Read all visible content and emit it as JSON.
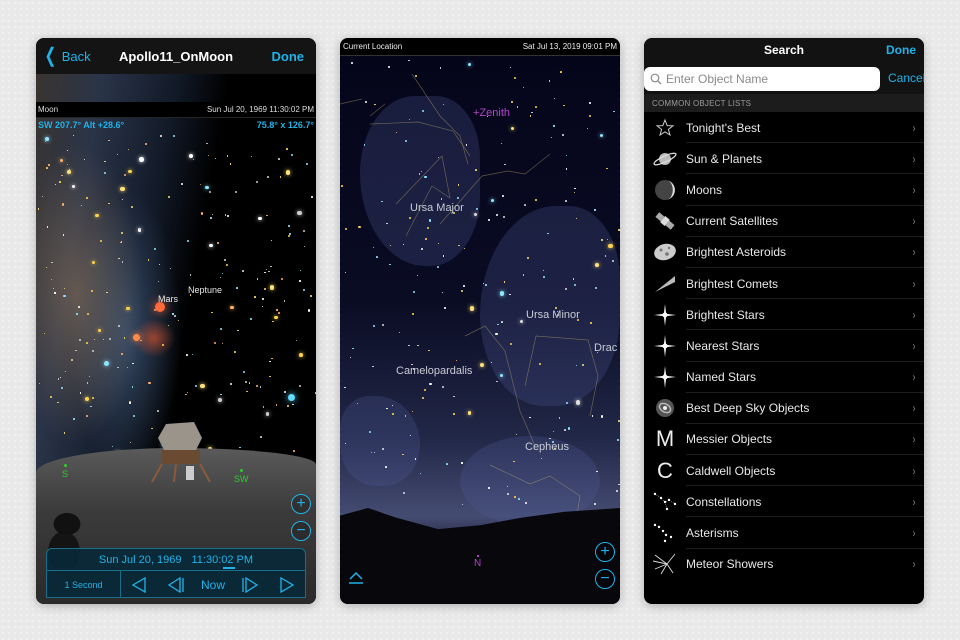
{
  "phone1": {
    "nav": {
      "back_label": "Back",
      "title": "Apollo11_OnMoon",
      "done_label": "Done"
    },
    "info": {
      "object": "Moon",
      "datetime": "Sun Jul 20, 1969  11:30:02 PM",
      "direction": "SW 207.7° Alt +28.6°",
      "field_of_view": "75.8° x 126.7°"
    },
    "sky_labels": {
      "mars": "Mars",
      "neptune": "Neptune"
    },
    "compass": {
      "south": "S",
      "southwest": "SW"
    },
    "zoom": {
      "in": "+",
      "out": "−"
    },
    "time_control": {
      "date": "Sun Jul 20, 1969",
      "time": "11:30:02 PM",
      "step": "1 Second",
      "now": "Now"
    }
  },
  "phone2": {
    "status": {
      "location": "Current Location",
      "datetime": "Sat Jul 13, 2019  09:01 PM"
    },
    "markers": {
      "zenith": "Zenith",
      "north": "N"
    },
    "constellations": [
      "Ursa Major",
      "Ursa Minor",
      "Camelopardalis",
      "Cepheus",
      "Drac"
    ],
    "zoom": {
      "in": "+",
      "out": "−"
    }
  },
  "phone3": {
    "nav": {
      "title": "Search",
      "done_label": "Done"
    },
    "search": {
      "placeholder": "Enter Object Name",
      "value": "",
      "cancel_label": "Cancel"
    },
    "section_header": "COMMON OBJECT LISTS",
    "items": [
      {
        "label": "Tonight's Best",
        "icon": "star-outline-icon"
      },
      {
        "label": "Sun & Planets",
        "icon": "planet-icon"
      },
      {
        "label": "Moons",
        "icon": "moon-icon"
      },
      {
        "label": "Current Satellites",
        "icon": "satellite-icon"
      },
      {
        "label": "Brightest Asteroids",
        "icon": "asteroid-icon"
      },
      {
        "label": "Brightest Comets",
        "icon": "comet-icon"
      },
      {
        "label": "Brightest Stars",
        "icon": "star-sparkle-icon"
      },
      {
        "label": "Nearest Stars",
        "icon": "star-sparkle-icon"
      },
      {
        "label": "Named Stars",
        "icon": "star-sparkle-icon"
      },
      {
        "label": "Best Deep Sky Objects",
        "icon": "galaxy-icon"
      },
      {
        "label": "Messier Objects",
        "icon": "messier-icon"
      },
      {
        "label": "Caldwell Objects",
        "icon": "caldwell-icon"
      },
      {
        "label": "Constellations",
        "icon": "constellation-icon"
      },
      {
        "label": "Asterisms",
        "icon": "asterism-icon"
      },
      {
        "label": "Meteor Showers",
        "icon": "meteor-shower-icon"
      }
    ],
    "chevron": "›"
  },
  "colors": {
    "accent": "#1fb3ea",
    "marker": "#b443c9",
    "compass": "#2ecc2e"
  }
}
